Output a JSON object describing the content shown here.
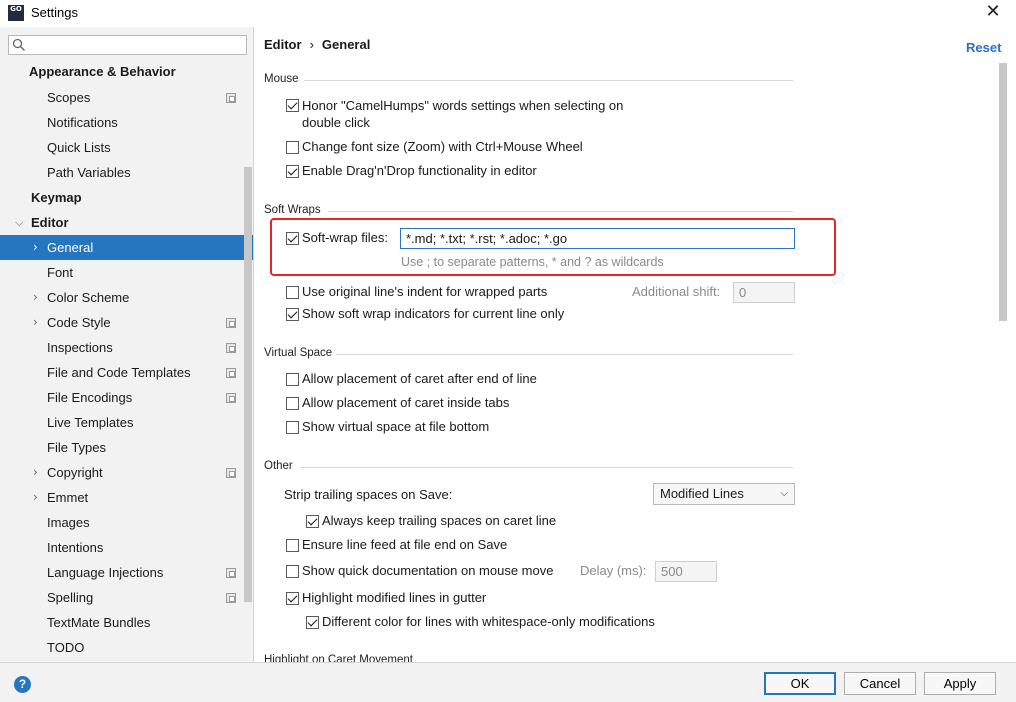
{
  "window": {
    "title": "Settings",
    "app_icon_text": "GO"
  },
  "sidebar": {
    "search_placeholder": "",
    "items": [
      {
        "label": "Appearance & Behavior"
      },
      {
        "label": "Scopes"
      },
      {
        "label": "Notifications"
      },
      {
        "label": "Quick Lists"
      },
      {
        "label": "Path Variables"
      },
      {
        "label": "Keymap"
      },
      {
        "label": "Editor"
      },
      {
        "label": "General"
      },
      {
        "label": "Font"
      },
      {
        "label": "Color Scheme"
      },
      {
        "label": "Code Style"
      },
      {
        "label": "Inspections"
      },
      {
        "label": "File and Code Templates"
      },
      {
        "label": "File Encodings"
      },
      {
        "label": "Live Templates"
      },
      {
        "label": "File Types"
      },
      {
        "label": "Copyright"
      },
      {
        "label": "Emmet"
      },
      {
        "label": "Images"
      },
      {
        "label": "Intentions"
      },
      {
        "label": "Language Injections"
      },
      {
        "label": "Spelling"
      },
      {
        "label": "TextMate Bundles"
      },
      {
        "label": "TODO"
      }
    ]
  },
  "header": {
    "crumb_parent": "Editor",
    "crumb_sep": "›",
    "crumb_current": "General",
    "reset_label": "Reset"
  },
  "mouse": {
    "title": "Mouse",
    "camelhumps_line1": "Honor \"CamelHumps\" words settings when selecting on",
    "camelhumps_line2": "double click",
    "zoom": "Change font size (Zoom) with Ctrl+Mouse Wheel",
    "dragdrop": "Enable Drag'n'Drop functionality in editor"
  },
  "soft_wraps": {
    "title": "Soft Wraps",
    "files_label": "Soft-wrap files:",
    "files_value": "*.md; *.txt; *.rst; *.adoc; *.go",
    "files_hint": "Use ; to separate patterns, * and ? as wildcards",
    "original_indent": "Use original line's indent for wrapped parts",
    "additional_shift_label": "Additional shift:",
    "additional_shift_value": "0",
    "show_indicators": "Show soft wrap indicators for current line only"
  },
  "virtual_space": {
    "title": "Virtual Space",
    "after_end": "Allow placement of caret after end of line",
    "inside_tabs": "Allow placement of caret inside tabs",
    "file_bottom": "Show virtual space at file bottom"
  },
  "other": {
    "title": "Other",
    "strip_label": "Strip trailing spaces on Save:",
    "strip_value": "Modified Lines",
    "keep_trailing": "Always keep trailing spaces on caret line",
    "line_feed": "Ensure line feed at file end on Save",
    "quick_doc": "Show quick documentation on mouse move",
    "delay_label": "Delay (ms):",
    "delay_value": "500",
    "highlight_modified": "Highlight modified lines in gutter",
    "different_color": "Different color for lines with whitespace-only modifications"
  },
  "next_section_title": "Highlight on Caret Movement",
  "buttons": {
    "ok": "OK",
    "cancel": "Cancel",
    "apply": "Apply",
    "help": "?"
  }
}
